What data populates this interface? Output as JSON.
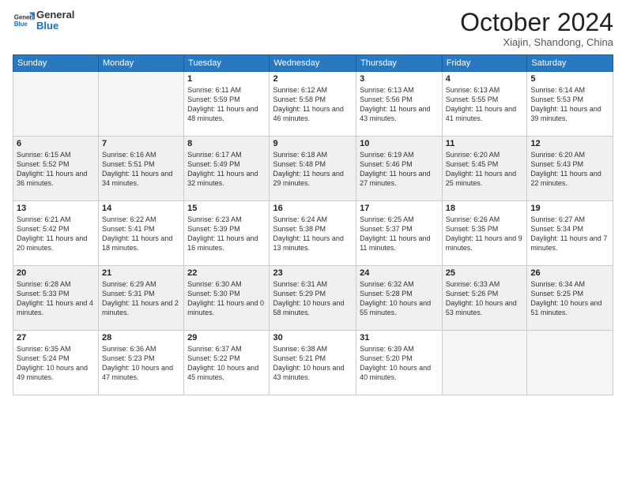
{
  "header": {
    "logo": {
      "general": "General",
      "blue": "Blue"
    },
    "title": "October 2024",
    "location": "Xiajin, Shandong, China"
  },
  "days_of_week": [
    "Sunday",
    "Monday",
    "Tuesday",
    "Wednesday",
    "Thursday",
    "Friday",
    "Saturday"
  ],
  "weeks": [
    [
      {
        "day": "",
        "info": ""
      },
      {
        "day": "",
        "info": ""
      },
      {
        "day": "1",
        "info": "Sunrise: 6:11 AM\nSunset: 5:59 PM\nDaylight: 11 hours and 48 minutes."
      },
      {
        "day": "2",
        "info": "Sunrise: 6:12 AM\nSunset: 5:58 PM\nDaylight: 11 hours and 46 minutes."
      },
      {
        "day": "3",
        "info": "Sunrise: 6:13 AM\nSunset: 5:56 PM\nDaylight: 11 hours and 43 minutes."
      },
      {
        "day": "4",
        "info": "Sunrise: 6:13 AM\nSunset: 5:55 PM\nDaylight: 11 hours and 41 minutes."
      },
      {
        "day": "5",
        "info": "Sunrise: 6:14 AM\nSunset: 5:53 PM\nDaylight: 11 hours and 39 minutes."
      }
    ],
    [
      {
        "day": "6",
        "info": "Sunrise: 6:15 AM\nSunset: 5:52 PM\nDaylight: 11 hours and 36 minutes."
      },
      {
        "day": "7",
        "info": "Sunrise: 6:16 AM\nSunset: 5:51 PM\nDaylight: 11 hours and 34 minutes."
      },
      {
        "day": "8",
        "info": "Sunrise: 6:17 AM\nSunset: 5:49 PM\nDaylight: 11 hours and 32 minutes."
      },
      {
        "day": "9",
        "info": "Sunrise: 6:18 AM\nSunset: 5:48 PM\nDaylight: 11 hours and 29 minutes."
      },
      {
        "day": "10",
        "info": "Sunrise: 6:19 AM\nSunset: 5:46 PM\nDaylight: 11 hours and 27 minutes."
      },
      {
        "day": "11",
        "info": "Sunrise: 6:20 AM\nSunset: 5:45 PM\nDaylight: 11 hours and 25 minutes."
      },
      {
        "day": "12",
        "info": "Sunrise: 6:20 AM\nSunset: 5:43 PM\nDaylight: 11 hours and 22 minutes."
      }
    ],
    [
      {
        "day": "13",
        "info": "Sunrise: 6:21 AM\nSunset: 5:42 PM\nDaylight: 11 hours and 20 minutes."
      },
      {
        "day": "14",
        "info": "Sunrise: 6:22 AM\nSunset: 5:41 PM\nDaylight: 11 hours and 18 minutes."
      },
      {
        "day": "15",
        "info": "Sunrise: 6:23 AM\nSunset: 5:39 PM\nDaylight: 11 hours and 16 minutes."
      },
      {
        "day": "16",
        "info": "Sunrise: 6:24 AM\nSunset: 5:38 PM\nDaylight: 11 hours and 13 minutes."
      },
      {
        "day": "17",
        "info": "Sunrise: 6:25 AM\nSunset: 5:37 PM\nDaylight: 11 hours and 11 minutes."
      },
      {
        "day": "18",
        "info": "Sunrise: 6:26 AM\nSunset: 5:35 PM\nDaylight: 11 hours and 9 minutes."
      },
      {
        "day": "19",
        "info": "Sunrise: 6:27 AM\nSunset: 5:34 PM\nDaylight: 11 hours and 7 minutes."
      }
    ],
    [
      {
        "day": "20",
        "info": "Sunrise: 6:28 AM\nSunset: 5:33 PM\nDaylight: 11 hours and 4 minutes."
      },
      {
        "day": "21",
        "info": "Sunrise: 6:29 AM\nSunset: 5:31 PM\nDaylight: 11 hours and 2 minutes."
      },
      {
        "day": "22",
        "info": "Sunrise: 6:30 AM\nSunset: 5:30 PM\nDaylight: 11 hours and 0 minutes."
      },
      {
        "day": "23",
        "info": "Sunrise: 6:31 AM\nSunset: 5:29 PM\nDaylight: 10 hours and 58 minutes."
      },
      {
        "day": "24",
        "info": "Sunrise: 6:32 AM\nSunset: 5:28 PM\nDaylight: 10 hours and 55 minutes."
      },
      {
        "day": "25",
        "info": "Sunrise: 6:33 AM\nSunset: 5:26 PM\nDaylight: 10 hours and 53 minutes."
      },
      {
        "day": "26",
        "info": "Sunrise: 6:34 AM\nSunset: 5:25 PM\nDaylight: 10 hours and 51 minutes."
      }
    ],
    [
      {
        "day": "27",
        "info": "Sunrise: 6:35 AM\nSunset: 5:24 PM\nDaylight: 10 hours and 49 minutes."
      },
      {
        "day": "28",
        "info": "Sunrise: 6:36 AM\nSunset: 5:23 PM\nDaylight: 10 hours and 47 minutes."
      },
      {
        "day": "29",
        "info": "Sunrise: 6:37 AM\nSunset: 5:22 PM\nDaylight: 10 hours and 45 minutes."
      },
      {
        "day": "30",
        "info": "Sunrise: 6:38 AM\nSunset: 5:21 PM\nDaylight: 10 hours and 43 minutes."
      },
      {
        "day": "31",
        "info": "Sunrise: 6:39 AM\nSunset: 5:20 PM\nDaylight: 10 hours and 40 minutes."
      },
      {
        "day": "",
        "info": ""
      },
      {
        "day": "",
        "info": ""
      }
    ]
  ]
}
